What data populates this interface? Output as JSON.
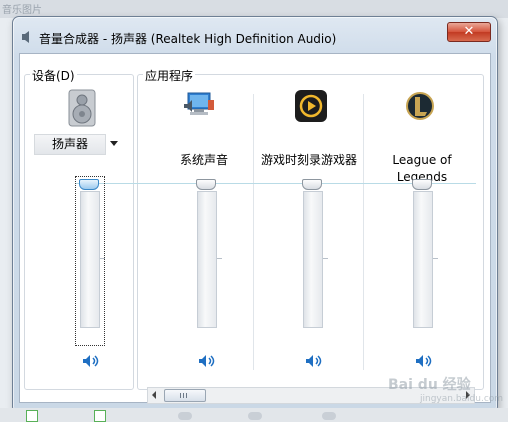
{
  "background": {
    "top_strip_text": "音乐图片"
  },
  "window": {
    "title": "音量合成器 - 扬声器 (Realtek High Definition Audio)",
    "close_label": "✕"
  },
  "device_group": {
    "label": "设备(D)",
    "selected_device": "扬声器",
    "speaker_icon": "speaker-mute-toggle-icon",
    "volume_percent": 100
  },
  "apps_group": {
    "label": "应用程序",
    "apps": [
      {
        "name": "系统声音",
        "icon": "system-sounds-icon",
        "volume_percent": 100
      },
      {
        "name": "游戏时刻录游戏器",
        "icon": "game-recorder-icon",
        "volume_percent": 100
      },
      {
        "name": "League of\nLegends",
        "name_line1": "League of",
        "name_line2": "Legends",
        "icon": "league-of-legends-icon",
        "volume_percent": 100
      }
    ]
  },
  "watermark": {
    "text": "Bai du 经验",
    "sub": "jingyan.baidu.com"
  },
  "colors": {
    "window_frame": "#cfdcea",
    "close_button": "#c94a30",
    "slider_line": "#b9dbe6",
    "focused_thumb": "#9dcaee"
  }
}
